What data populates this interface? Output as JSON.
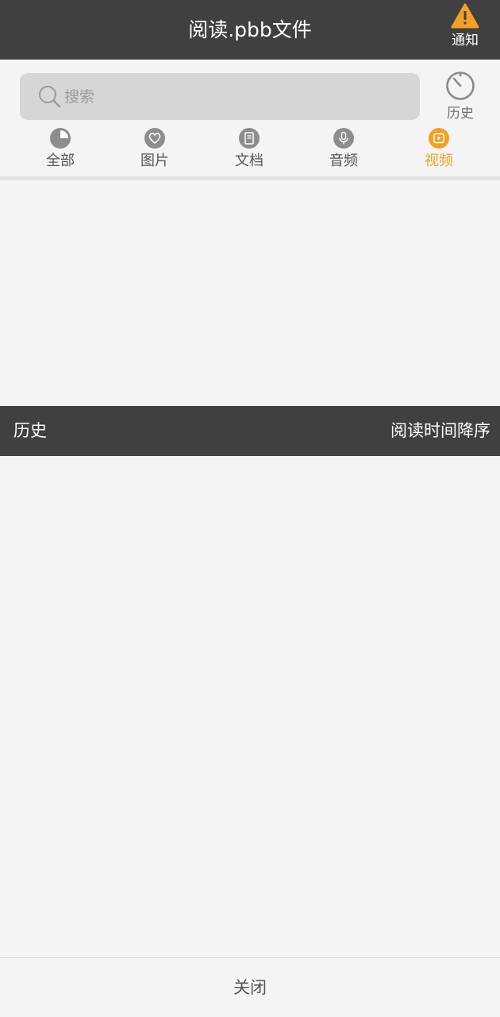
{
  "header": {
    "title": "阅读.pbb文件",
    "notify_label": "通知",
    "notify_icon": "warning-icon",
    "warning_color": "#f5a023"
  },
  "search": {
    "placeholder": "搜索",
    "value": "",
    "icon": "search-icon"
  },
  "history_button": {
    "label": "历史",
    "icon": "timer-icon"
  },
  "tabs": [
    {
      "label": "全部",
      "icon": "pie-chart-icon",
      "active": false
    },
    {
      "label": "图片",
      "icon": "heart-icon",
      "active": false
    },
    {
      "label": "文档",
      "icon": "document-icon",
      "active": false
    },
    {
      "label": "音频",
      "icon": "microphone-icon",
      "active": false
    },
    {
      "label": "视频",
      "icon": "video-icon",
      "active": true
    }
  ],
  "history_section": {
    "title": "历史",
    "sort_label": "阅读时间降序"
  },
  "footer": {
    "close_label": "关闭"
  },
  "colors": {
    "bar_bg": "#404040",
    "accent": "#f5a023",
    "page_bg": "#f4f4f4"
  }
}
